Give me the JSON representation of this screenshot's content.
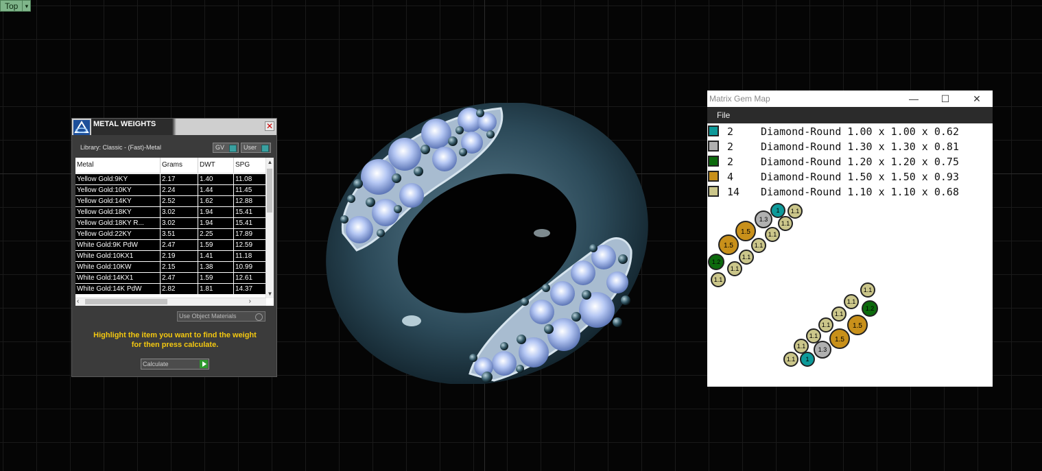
{
  "viewport": {
    "label": "Top",
    "colors": {
      "background": "#050505",
      "grid": "#1a1a1a",
      "label_bg": "#7fb58a"
    }
  },
  "metal_weights": {
    "title": "METAL WEIGHTS",
    "library": "Library: Classic - (Fast)-Metal",
    "gv_label": "GV",
    "user_label": "User",
    "columns": [
      "Metal",
      "Grams",
      "DWT",
      "SPG"
    ],
    "rows": [
      [
        "Yellow Gold:9KY",
        "2.17",
        "1.40",
        "11.08"
      ],
      [
        "Yellow Gold:10KY",
        "2.24",
        "1.44",
        "11.45"
      ],
      [
        "Yellow Gold:14KY",
        "2.52",
        "1.62",
        "12.88"
      ],
      [
        "Yellow Gold:18KY",
        "3.02",
        "1.94",
        "15.41"
      ],
      [
        "Yellow Gold:18KY R...",
        "3.02",
        "1.94",
        "15.41"
      ],
      [
        "Yellow Gold:22KY",
        "3.51",
        "2.25",
        "17.89"
      ],
      [
        "White Gold:9K PdW",
        "2.47",
        "1.59",
        "12.59"
      ],
      [
        "White Gold:10KX1",
        "2.19",
        "1.41",
        "11.18"
      ],
      [
        "White Gold:10KW",
        "2.15",
        "1.38",
        "10.99"
      ],
      [
        "White Gold:14KX1",
        "2.47",
        "1.59",
        "12.61"
      ],
      [
        "White Gold:14K PdW",
        "2.82",
        "1.81",
        "14.37"
      ]
    ],
    "use_object_materials": "Use Object Materials",
    "instruction_line1": "Highlight the item you want to find the weight",
    "instruction_line2": "for then press calculate.",
    "calculate_label": "Calculate",
    "colors": {
      "panel": "#3b3b3b",
      "instruction": "#f4c810"
    }
  },
  "gem_map": {
    "title": "Matrix Gem Map",
    "menu_file": "File",
    "legend": [
      {
        "count": "2",
        "description": "Diamond-Round 1.00 x 1.00 x 0.62",
        "color": "#0e9a9a"
      },
      {
        "count": "2",
        "description": "Diamond-Round 1.30 x 1.30 x 0.81",
        "color": "#b0b0b0"
      },
      {
        "count": "2",
        "description": "Diamond-Round 1.20 x 1.20 x 0.75",
        "color": "#0c6a0c"
      },
      {
        "count": "4",
        "description": "Diamond-Round 1.50 x 1.50 x 0.93",
        "color": "#c8901a"
      },
      {
        "count": "14",
        "description": "Diamond-Round 1.10 x 1.10 x 0.68",
        "color": "#cbc68a"
      }
    ],
    "stone_labels": {
      "s1": "1",
      "s13": "1.3",
      "s12": "1.2",
      "s15": "1.5",
      "s11": "1.1"
    }
  }
}
